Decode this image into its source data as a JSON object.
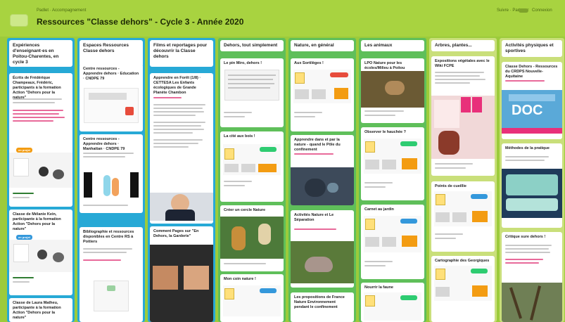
{
  "header": {
    "breadcrumb": "Padlet · Accompagnement",
    "title": "Ressources \"Classe dehors\" - Cycle 3 - Année 2020",
    "follow": "Suivre · Partager",
    "login": "Connexion"
  },
  "colors": {
    "topbar": "#a8d340",
    "background": "#9ccb3b",
    "column_blue": "#27a9d6",
    "column_green": "#5fbf5a",
    "accent_orange": "#f39c12",
    "accent_pink": "#e8307a",
    "accent_green": "#2ecc71",
    "accent_blue": "#3498db"
  },
  "columns": [
    {
      "title": "Expériences d'enseignant·es en Poitou-Charentes, en cycle 3"
    },
    {
      "title": "Espaces Ressources Classe dehors"
    },
    {
      "title": "Films et reportages pour découvrir la Classe dehors"
    },
    {
      "title": "Dehors, tout simplement"
    },
    {
      "title": "Nature, en général"
    },
    {
      "title": "Les animaux"
    },
    {
      "title": "Arbres, plantes..."
    },
    {
      "title": "Activités physiques et sportives"
    }
  ],
  "cards": {
    "c1a": "Écrits de Frédérique Champeaux, Frédéric, participants à la formation Action \"Dehors pour la nature\"",
    "c1b": "Classe de Mélanie Kein, participante à la formation Action \"Dehors pour la nature\"",
    "c1c": "Classe de Laura Matheu, participante à la formation Action \"Dehors pour la nature\"",
    "c2a": "Centre ressources - Apprendre dehors · Education · CNDPE 79",
    "c2b": "Centre ressources - Apprendre dehors · Manhattan · CNDPE 79",
    "c2c": "Bibliographie et ressources disponibles en Centre RS à Poitiers",
    "c3a": "Apprendre en Forêt (1/8) · CETTESA Les Enfants écologiques de Grande Planète Chambon",
    "c3b": "Comment Pages sur \"En Dehors, la Garderie\"",
    "c4a": "Le pin Miro, dehors !",
    "c4b": "La cité aux bois !",
    "c4c": "Créer un cercle Nature",
    "c4d": "Mon coin nature !",
    "c5a": "Aux Sortilèges !",
    "c5b": "Apprendre dans et par la nature - quand le Pôle du confinement",
    "c5c": "Activités Nature et Le Séparation",
    "c5d": "Les propositions de France Nature Environnement pendant le confinement",
    "c6a": "LPO Nature pour les écoles/Milieu à Poitou",
    "c6b": "Observer le hauchée ?",
    "c6c": "Carnet au jardin",
    "c6d": "Nourrir la faune",
    "c7a": "Expositions végétales avec le Wiki FCPE",
    "c7b": "Points de cueillie",
    "c7c": "Cartographie des Georgiques",
    "c8a": "Classe Dehors - Ressources du CRDPS Nouvelle-Aquitaine",
    "c8b": "Méthodes de la pratique",
    "c8c": "Critique sure dehors !"
  },
  "badges": {
    "orange": "en projet",
    "green": "en projet",
    "blue": "en projet",
    "pink": "en projet"
  },
  "misc": {
    "doc_label": "DOC"
  }
}
